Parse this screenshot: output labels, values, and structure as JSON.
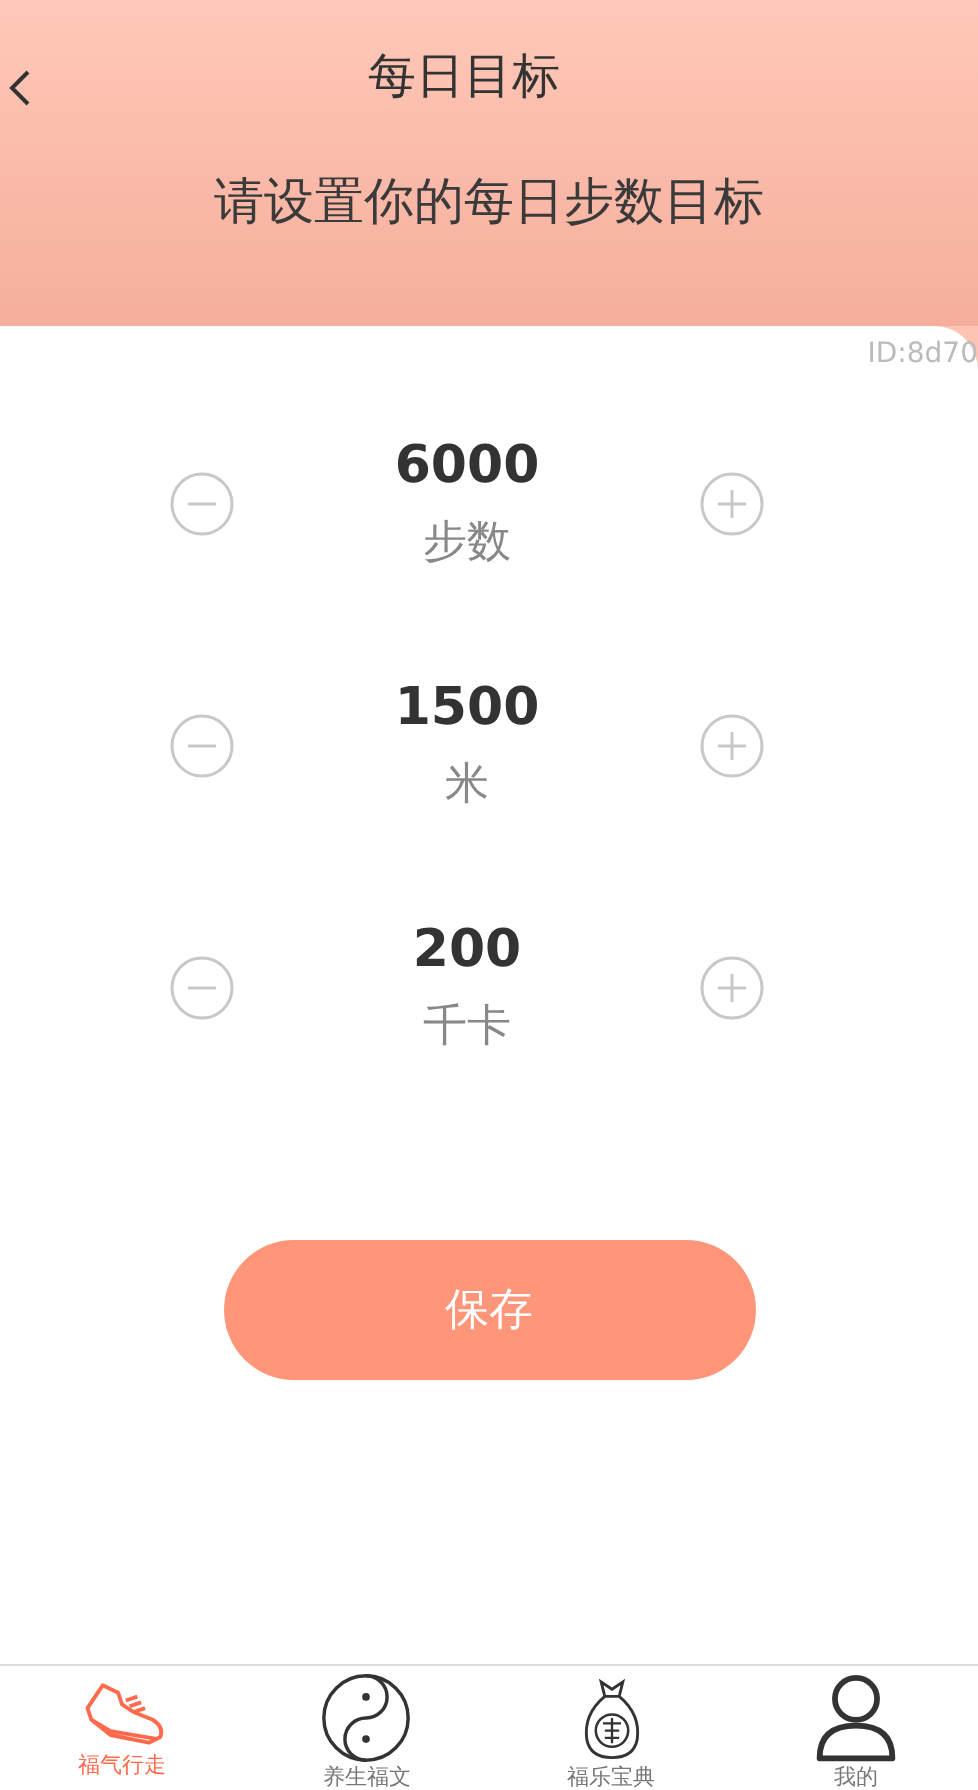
{
  "header": {
    "title": "每日目标",
    "subtitle": "请设置你的每日步数目标"
  },
  "id_text": "ID:8d70",
  "goals": [
    {
      "value": "6000",
      "unit": "步数"
    },
    {
      "value": "1500",
      "unit": "米"
    },
    {
      "value": "200",
      "unit": "千卡"
    }
  ],
  "save_button": "保存",
  "nav": [
    {
      "kind": "shoe",
      "label": "福气行走",
      "selected": true
    },
    {
      "kind": "yinyang",
      "label": "养生福文",
      "selected": false
    },
    {
      "kind": "bag",
      "label": "福乐宝典",
      "selected": false
    },
    {
      "kind": "person",
      "label": "我的",
      "selected": false
    }
  ]
}
